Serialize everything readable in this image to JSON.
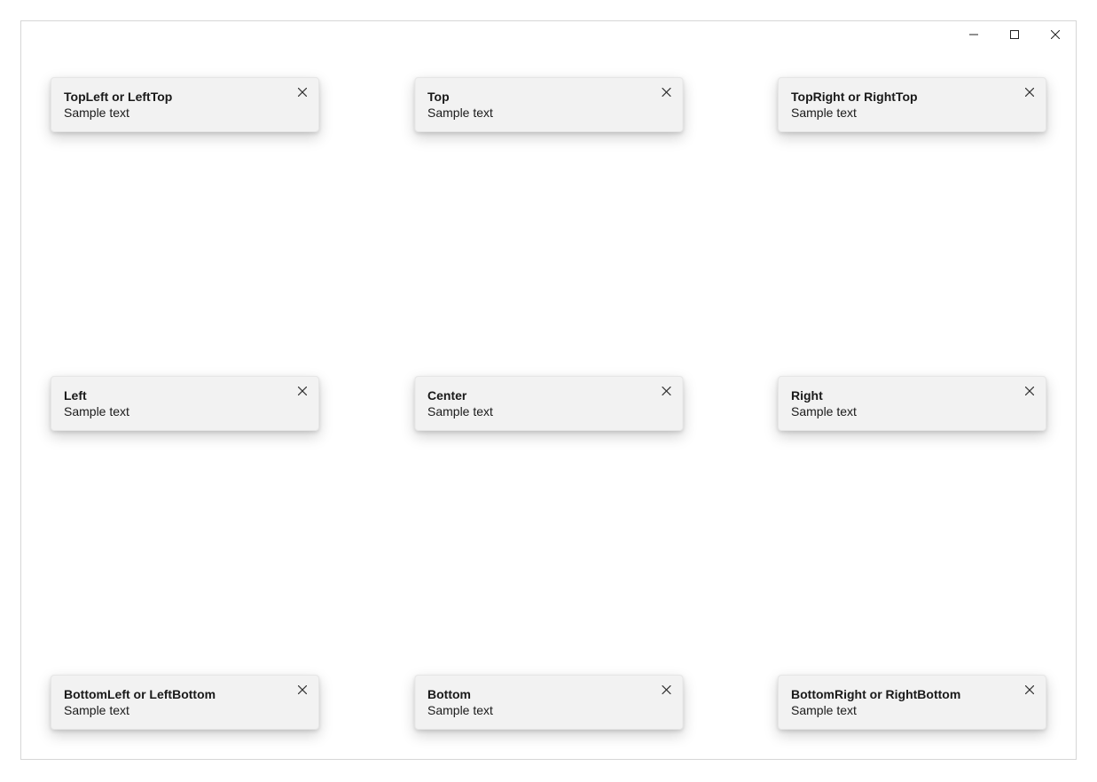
{
  "cards": {
    "topleft": {
      "title": "TopLeft or LeftTop",
      "body": "Sample text"
    },
    "top": {
      "title": "Top",
      "body": "Sample text"
    },
    "topright": {
      "title": "TopRight or RightTop",
      "body": "Sample text"
    },
    "left": {
      "title": "Left",
      "body": "Sample text"
    },
    "center": {
      "title": "Center",
      "body": "Sample text"
    },
    "right": {
      "title": "Right",
      "body": "Sample text"
    },
    "bottomleft": {
      "title": "BottomLeft or LeftBottom",
      "body": "Sample text"
    },
    "bottom": {
      "title": "Bottom",
      "body": "Sample text"
    },
    "bottomright": {
      "title": "BottomRight or RightBottom",
      "body": "Sample text"
    }
  }
}
